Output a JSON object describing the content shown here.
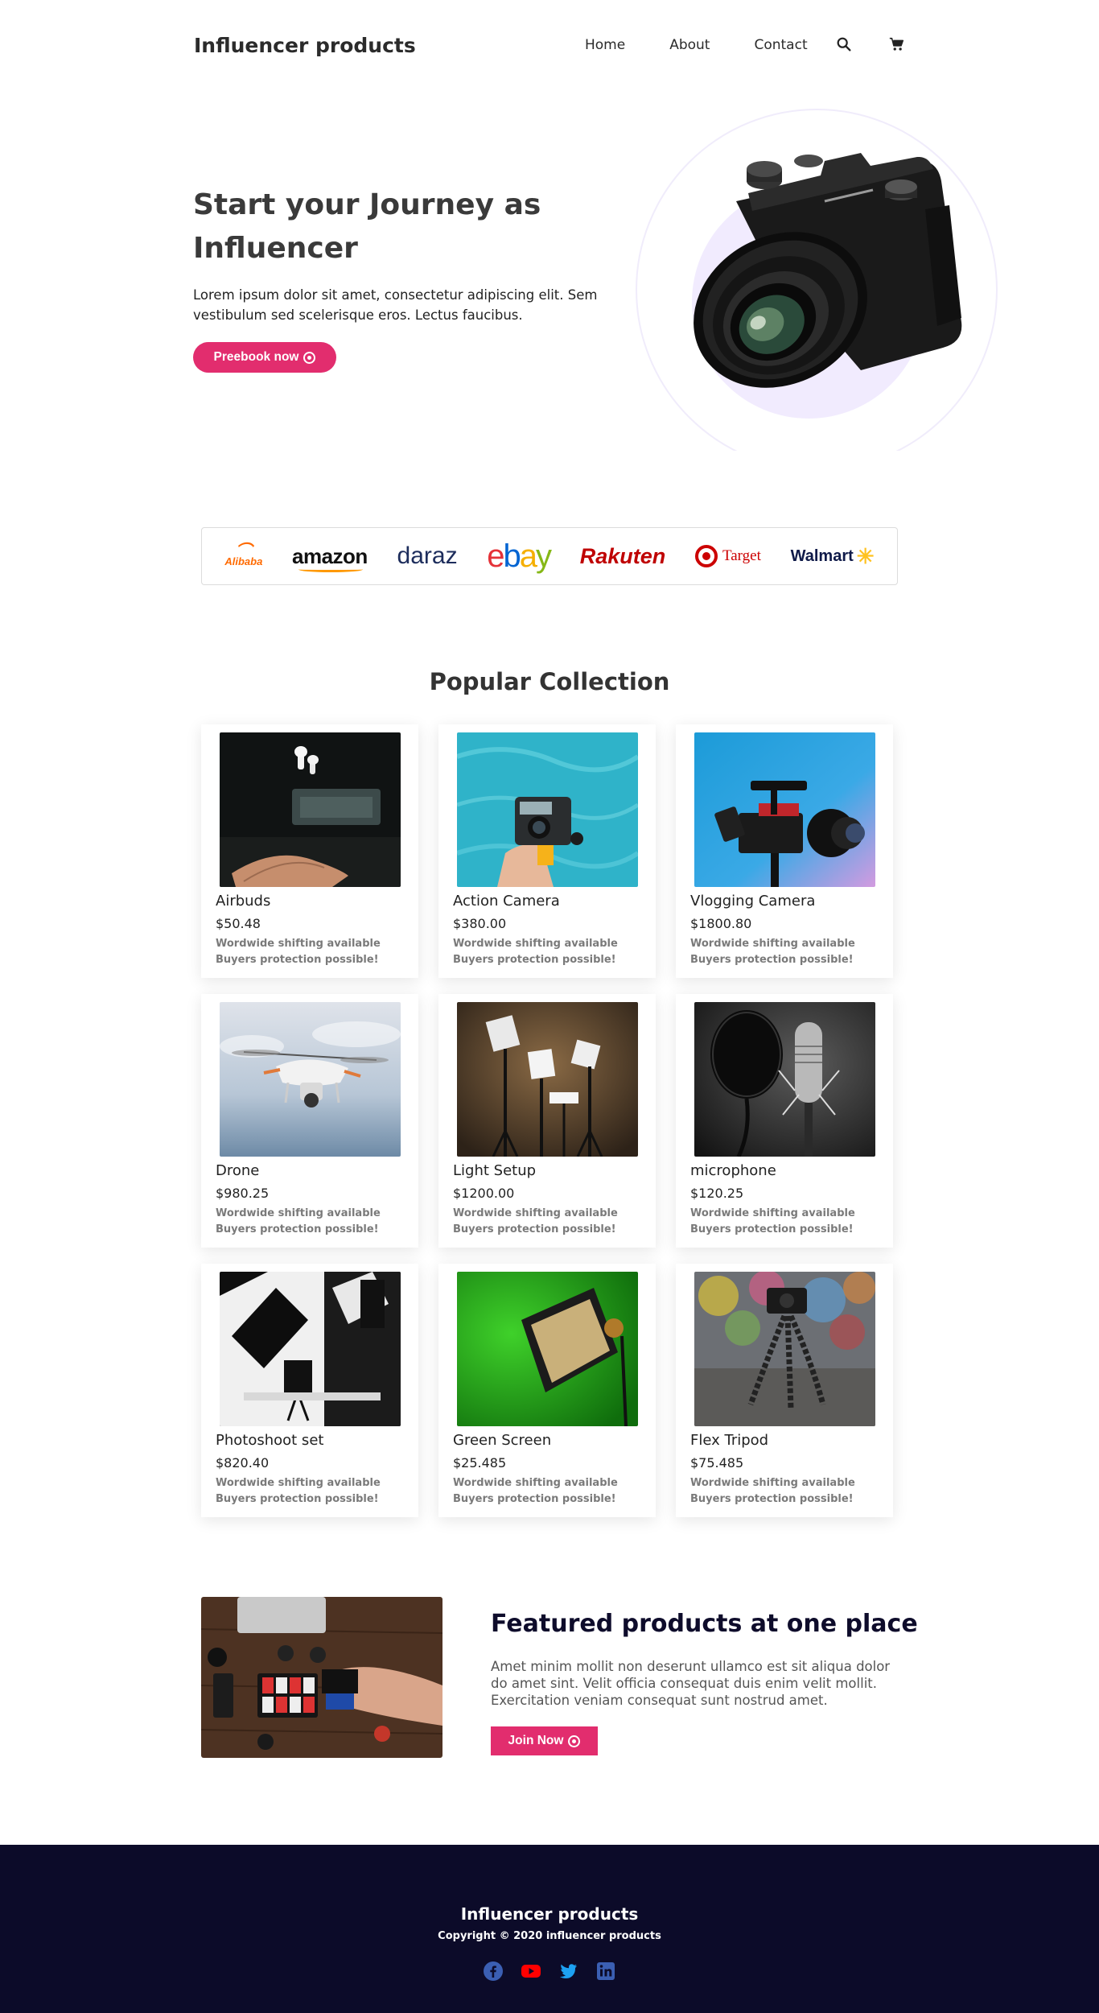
{
  "header": {
    "brand": "Influencer products",
    "nav": [
      "Home",
      "About",
      "Contact"
    ],
    "icons": [
      "search-icon",
      "cart-icon"
    ]
  },
  "hero": {
    "title": "Start your Journey as Influencer",
    "text": "Lorem ipsum dolor sit amet, consectetur adipiscing elit. Sem vestibulum sed scelerisque eros. Lectus faucibus.",
    "button": "Preebook now"
  },
  "partners": {
    "alibaba": "Alibaba",
    "amazon": "amazon",
    "daraz": "daraz",
    "ebay": [
      "e",
      "b",
      "a",
      "y"
    ],
    "rakuten": "Rakuten",
    "target": "Target",
    "walmart": "Walmart"
  },
  "collection": {
    "title": "Popular Collection",
    "shipping": "Wordwide shifting available",
    "protection": "Buyers protection possible!",
    "products": [
      {
        "name": "Airbuds",
        "price": "$50.48"
      },
      {
        "name": "Action Camera",
        "price": "$380.00"
      },
      {
        "name": "Vlogging Camera",
        "price": "$1800.80"
      },
      {
        "name": "Drone",
        "price": "$980.25"
      },
      {
        "name": "Light Setup",
        "price": "$1200.00"
      },
      {
        "name": "microphone",
        "price": "$120.25"
      },
      {
        "name": "Photoshoot set",
        "price": "$820.40"
      },
      {
        "name": "Green Screen",
        "price": "$25.485"
      },
      {
        "name": "Flex Tripod",
        "price": "$75.485"
      }
    ]
  },
  "featured": {
    "title": "Featured products at one place",
    "text": "Amet minim mollit non deserunt ullamco est sit aliqua dolor do amet sint. Velit officia consequat duis enim velit mollit. Exercitation veniam consequat sunt nostrud amet.",
    "button": "Join Now"
  },
  "footer": {
    "brand": "Influencer products",
    "copyright": "Copyright © 2020 influencer products",
    "socials": [
      "facebook-icon",
      "youtube-icon",
      "twitter-icon",
      "linkedin-icon"
    ]
  },
  "colors": {
    "accent": "#e22d6e",
    "footer_bg": "#0c0b29",
    "hero_circle": "#f1ebfe"
  }
}
